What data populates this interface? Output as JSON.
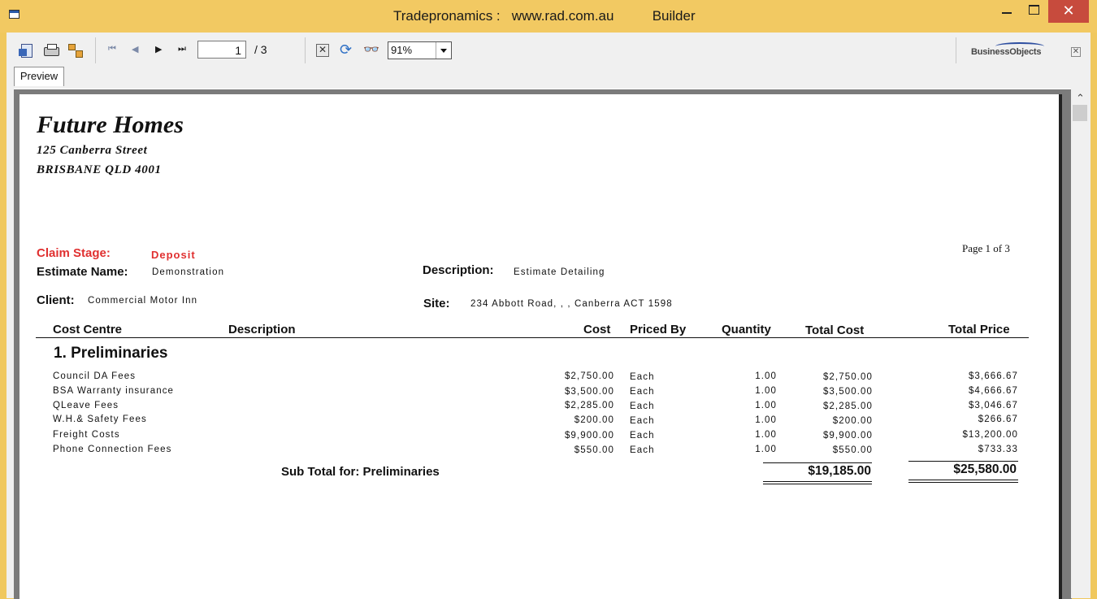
{
  "window": {
    "title": "Tradepronamics :   www.rad.com.au          Builder",
    "close_glyph": "✕"
  },
  "toolbar": {
    "nav_first": "⏮",
    "nav_prev": "◀",
    "nav_next": "▶",
    "nav_last": "⏭",
    "page_current": "1",
    "page_total": "/ 3",
    "stop_glyph": "✕",
    "refresh_glyph": "⟳",
    "search_glyph": "👓",
    "zoom": "91%",
    "logo_text": "BusinessObjects",
    "close_glyph": "✕",
    "tab_label": "Preview"
  },
  "report": {
    "company": "Future Homes",
    "address_line1": "125 Canberra Street",
    "address_line2": "BRISBANE  QLD 4001",
    "page_info": "Page 1 of 3",
    "claim_stage_label": "Claim Stage:",
    "claim_stage_value": "Deposit",
    "estimate_name_label": "Estimate Name:",
    "estimate_name_value": "Demonstration",
    "description_label": "Description:",
    "description_value": "Estimate Detailing",
    "client_label": "Client:",
    "client_value": "Commercial Motor Inn",
    "site_label": "Site:",
    "site_value": "234 Abbott Road, , , Canberra  ACT 1598",
    "columns": {
      "cost_centre": "Cost Centre",
      "description": "Description",
      "cost": "Cost",
      "priced_by": "Priced By",
      "quantity": "Quantity",
      "total_cost": "Total Cost",
      "total_price": "Total Price"
    },
    "section_title": "1. Preliminaries",
    "rows": [
      {
        "name": "Council DA Fees",
        "cost": "$2,750.00",
        "priced_by": "Each",
        "quantity": "1.00",
        "total_cost": "$2,750.00",
        "total_price": "$3,666.67"
      },
      {
        "name": "BSA Warranty insurance",
        "cost": "$3,500.00",
        "priced_by": "Each",
        "quantity": "1.00",
        "total_cost": "$3,500.00",
        "total_price": "$4,666.67"
      },
      {
        "name": "QLeave Fees",
        "cost": "$2,285.00",
        "priced_by": "Each",
        "quantity": "1.00",
        "total_cost": "$2,285.00",
        "total_price": "$3,046.67"
      },
      {
        "name": "W.H.& Safety Fees",
        "cost": "$200.00",
        "priced_by": "Each",
        "quantity": "1.00",
        "total_cost": "$200.00",
        "total_price": "$266.67"
      },
      {
        "name": "Freight Costs",
        "cost": "$9,900.00",
        "priced_by": "Each",
        "quantity": "1.00",
        "total_cost": "$9,900.00",
        "total_price": "$13,200.00"
      },
      {
        "name": "Phone Connection Fees",
        "cost": "$550.00",
        "priced_by": "Each",
        "quantity": "1.00",
        "total_cost": "$550.00",
        "total_price": "$733.33"
      }
    ],
    "subtotal_label": "Sub Total for: Preliminaries",
    "subtotal_cost": "$19,185.00",
    "subtotal_price": "$25,580.00"
  }
}
